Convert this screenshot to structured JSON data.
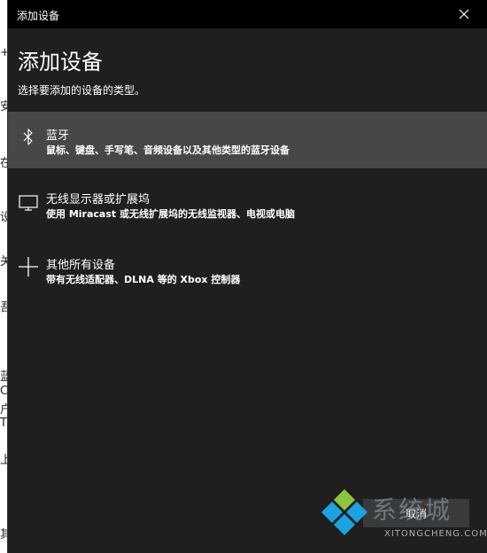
{
  "window": {
    "title": "添加设备",
    "heading": "添加设备",
    "subheading": "选择要添加的设备的类型。"
  },
  "options": [
    {
      "title": "蓝牙",
      "description": "鼠标、键盘、手写笔、音频设备以及其他类型的蓝牙设备",
      "icon": "bluetooth-icon",
      "selected": true
    },
    {
      "title": "无线显示器或扩展坞",
      "description": "使用 Miracast 或无线扩展坞的无线监视器、电视或电脑",
      "icon": "monitor-icon",
      "selected": false
    },
    {
      "title": "其他所有设备",
      "description": "带有无线适配器、DLNA 等的 Xbox 控制器",
      "icon": "plus-icon",
      "selected": false
    }
  ],
  "footer": {
    "cancel_label": "取消"
  },
  "watermark": {
    "text": "系统城",
    "sub": "XITONGCHENG.COM"
  },
  "background_fragments": [
    "+",
    "安",
    "在",
    "设",
    "关",
    "吾",
    "蓝",
    "C",
    "户",
    "T",
    "上",
    "其"
  ],
  "colors": {
    "window_bg": "#1f1f1f",
    "titlebar_bg": "#000000",
    "selected_bg": "#474747",
    "text": "#ffffff"
  }
}
